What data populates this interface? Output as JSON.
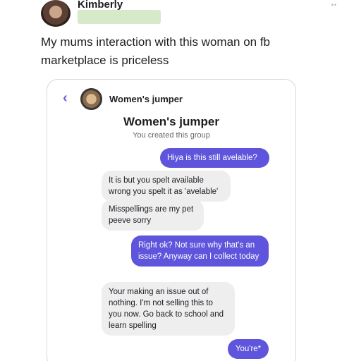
{
  "post": {
    "author": "Kimberly",
    "menu_icon": "more-dots-icon",
    "text": "My mums interaction with this woman on fb marketplace is priceless"
  },
  "chat": {
    "header_name": "Women's jumper",
    "back_icon": "chevron-left-icon",
    "accent_color": "#5e55dc",
    "group_title": "Women's jumper",
    "group_subtitle": "You created this group",
    "messages": [
      {
        "side": "out",
        "text": "Hiya is this still avelable?"
      },
      {
        "side": "in",
        "text": "It is but you spelt available wrong you spelt it as 'avelable'"
      },
      {
        "side": "in",
        "text": "Misspellings are my pet peeve sorry"
      },
      {
        "side": "out",
        "text": "Right ok? Not sure why that's an issue? Anyway can I collect today"
      },
      {
        "side": "in",
        "text": "Your making an issue out of nothing. I'm not selling this to you now. Go back to school and learn spelling"
      },
      {
        "side": "out",
        "text": "You're*"
      }
    ]
  }
}
